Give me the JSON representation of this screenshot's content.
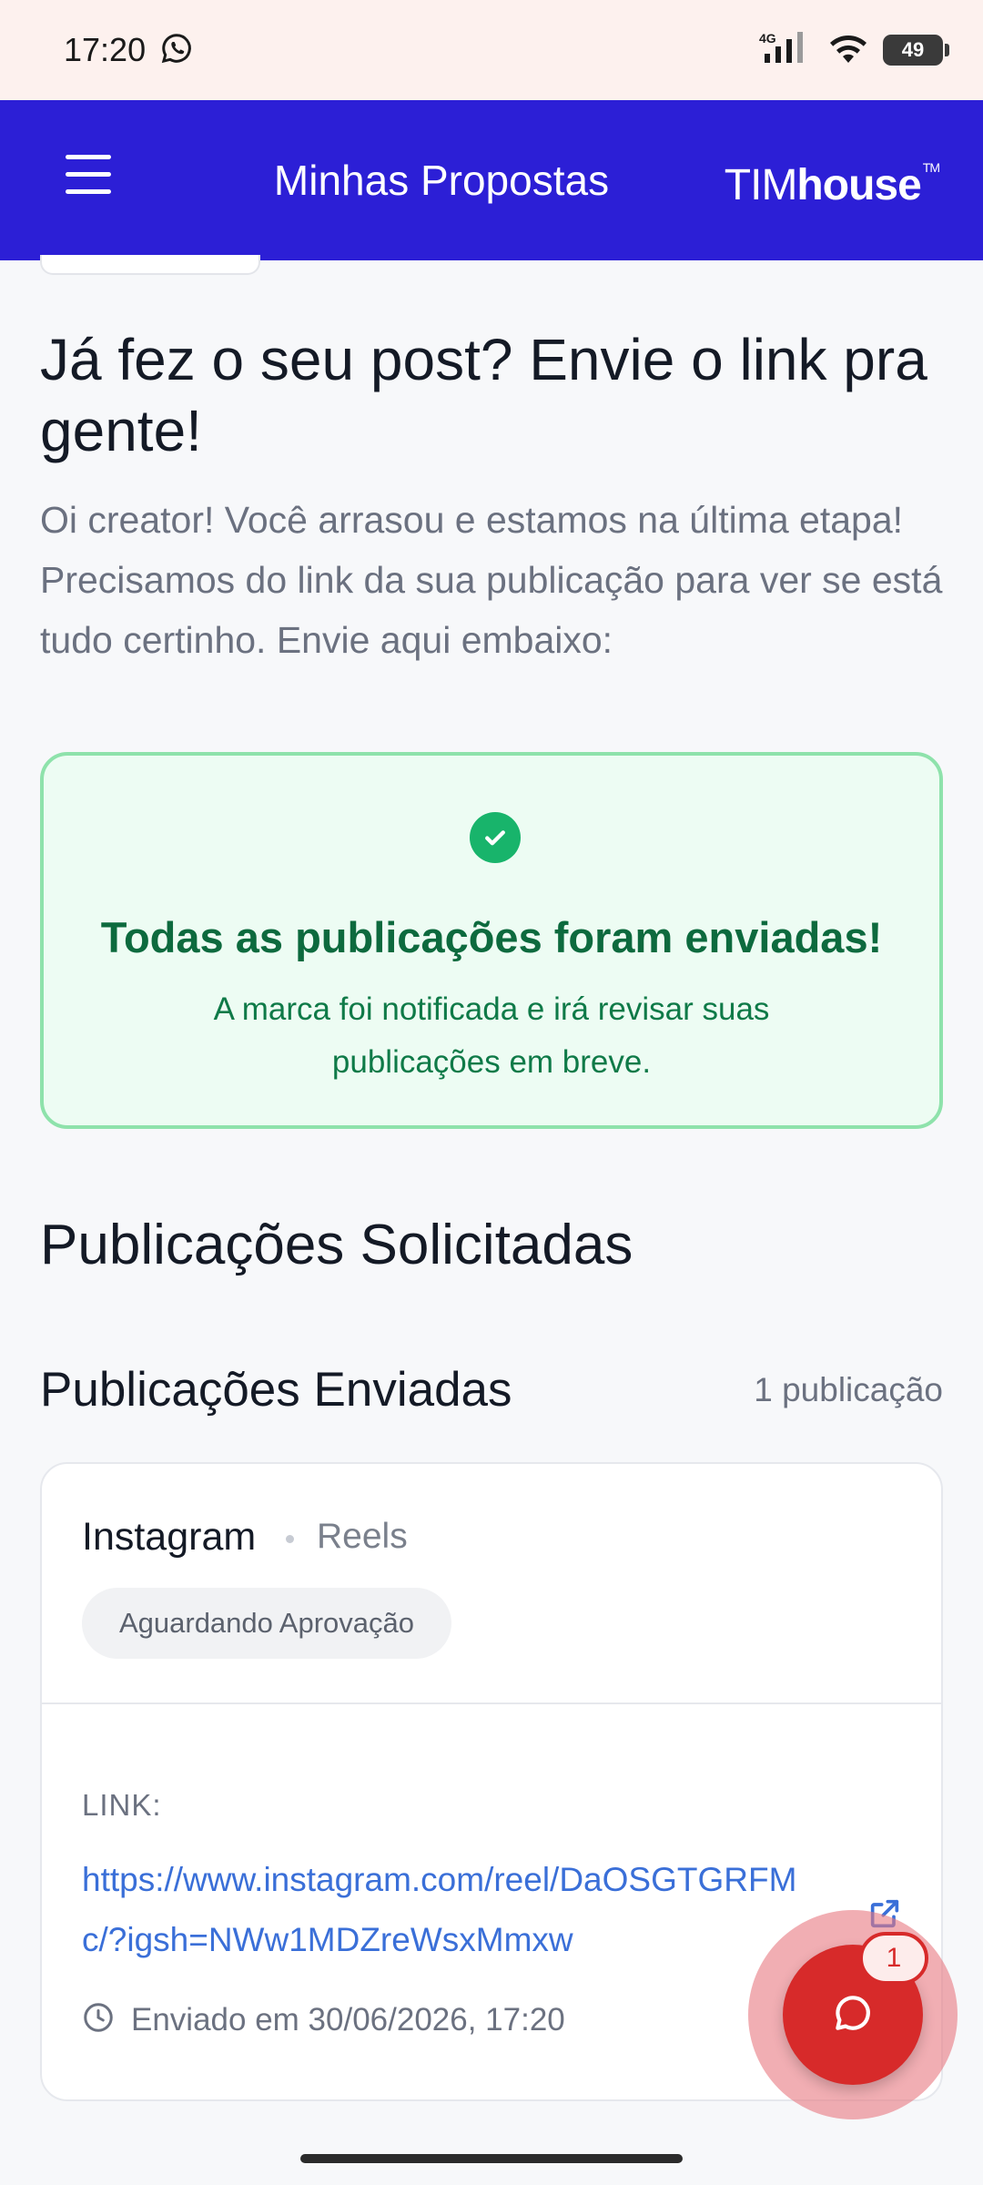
{
  "status_bar": {
    "time": "17:20",
    "network": "4G",
    "battery": "49",
    "icons": [
      "whatsapp-icon",
      "signal-icon",
      "wifi-icon",
      "battery-icon"
    ]
  },
  "header": {
    "title": "Minhas Propostas",
    "brand_part1": "TIM",
    "brand_part2": "house",
    "brand_tm": "TM"
  },
  "intro": {
    "title": "Já fez o seu post? Envie o link pra gente!",
    "text": "Oi creator! Você arrasou e estamos na última etapa! Precisamos do link da sua publicação para ver se está tudo certinho. Envie aqui embaixo:"
  },
  "success": {
    "title": "Todas as publicações foram enviadas!",
    "text": "A marca foi notificada e irá revisar suas publicações em breve."
  },
  "sections": {
    "requested_title": "Publicações Solicitadas",
    "sent_title": "Publicações Enviadas",
    "sent_count": "1 publicação"
  },
  "publication": {
    "platform": "Instagram",
    "format": "Reels",
    "status": "Aguardando Aprovação",
    "link_label": "LINK:",
    "link_url": "https://www.instagram.com/reel/DaOSGTGRFMc/?igsh=NWw1MDZreWsxMmxw",
    "sent_at": "Enviado em 30/06/2026, 17:20"
  },
  "chat": {
    "badge_count": "1"
  },
  "colors": {
    "header_bg": "#2c1fd6",
    "success_bg": "#edfcf3",
    "success_border": "#8ee2ab",
    "success_text": "#0d6a3e",
    "link": "#3a6fd8",
    "chat_red": "#d72a2a"
  }
}
